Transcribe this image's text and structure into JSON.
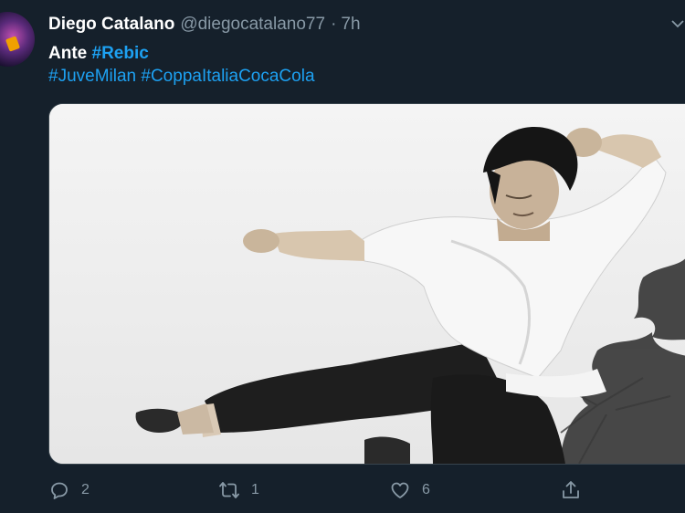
{
  "tweet": {
    "author": {
      "display_name": "Diego Catalano",
      "handle": "@diegocatalano77",
      "separator": "·",
      "time": "7h"
    },
    "text": {
      "word": "Ante",
      "hashtag_1": "#Rebic",
      "hashtag_2": "#JuveMilan",
      "hashtag_3": "#CoppaItaliaCocaCola"
    },
    "media": {
      "icon": "photo-image"
    },
    "actions": {
      "reply": {
        "icon": "reply-icon",
        "count": "2"
      },
      "retweet": {
        "icon": "retweet-icon",
        "count": "1"
      },
      "like": {
        "icon": "heart-icon",
        "count": "6"
      },
      "share": {
        "icon": "share-icon"
      }
    }
  },
  "colors": {
    "background": "#15202b",
    "link": "#1da1f2",
    "muted": "#8899a6",
    "text": "#ffffff"
  }
}
